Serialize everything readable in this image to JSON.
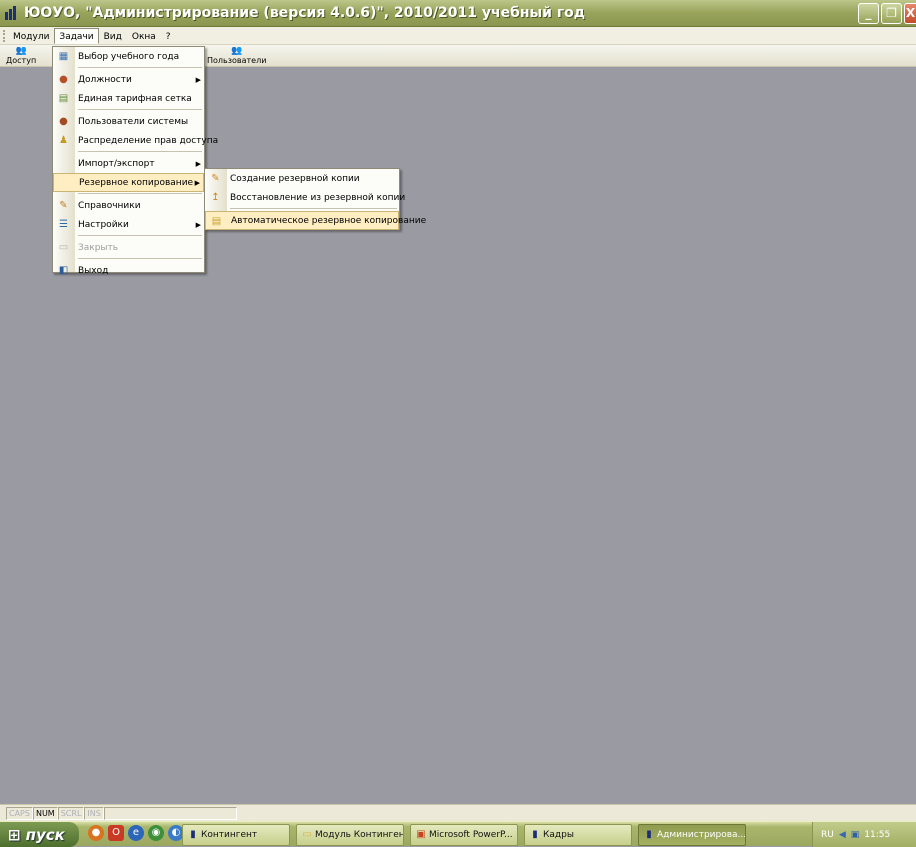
{
  "window": {
    "title": "ЮОУО, \"Администрирование (версия 4.0.6)\", 2010/2011 учебный год",
    "buttons": [
      "_",
      "❐",
      "X"
    ]
  },
  "menubar": {
    "items": [
      "Модули",
      "Задачи",
      "Вид",
      "Окна",
      "?"
    ],
    "active": "Задачи"
  },
  "toolbar": {
    "doc_label": "Доступ",
    "users_label": "Пользователи"
  },
  "tasks_menu": {
    "items": [
      {
        "label": "Выбор учебного года",
        "icon": "calendar-icon"
      },
      {
        "label": "Должности",
        "icon": "positions-icon",
        "submenu": true
      },
      {
        "label": "Единая тарифная сетка",
        "icon": "tariff-grid-icon"
      },
      {
        "label": "Пользователи системы",
        "icon": "users-icon"
      },
      {
        "label": "Распределение прав доступа",
        "icon": "access-rights-icon"
      },
      {
        "label": "Импорт/экспорт",
        "icon": "none",
        "submenu": true
      },
      {
        "label": "Резервное копирование",
        "icon": "none",
        "submenu": true,
        "highlighted": true
      },
      {
        "label": "Справочники",
        "icon": "directories-icon"
      },
      {
        "label": "Настройки",
        "icon": "settings-icon",
        "submenu": true
      },
      {
        "label": "Закрыть",
        "icon": "close-doc-icon",
        "disabled": true
      },
      {
        "label": "Выход",
        "icon": "exit-icon"
      }
    ]
  },
  "backup_submenu": {
    "items": [
      {
        "label": "Создание резервной копии",
        "icon": "create-backup-icon"
      },
      {
        "label": "Восстановление из резервной копии",
        "icon": "restore-backup-icon"
      },
      {
        "label": "Автоматическое резервное копирование",
        "icon": "auto-backup-icon",
        "highlighted": true
      }
    ]
  },
  "statusbar": {
    "indicators": [
      {
        "label": "CAPS",
        "on": false
      },
      {
        "label": "NUM",
        "on": true
      },
      {
        "label": "SCRL",
        "on": false
      },
      {
        "label": "INS",
        "on": false
      }
    ]
  },
  "taskbar": {
    "start_label": "пуск",
    "tasks": [
      {
        "label": "Контингент",
        "active": false
      },
      {
        "label": "Модуль Контингент",
        "active": false
      },
      {
        "label": "Microsoft PowerP...",
        "active": false
      },
      {
        "label": "Кадры",
        "active": false
      },
      {
        "label": "Администрирова...",
        "active": true
      }
    ],
    "tray": {
      "lang": "RU",
      "time": "11:55"
    }
  },
  "colors": {
    "workspace": "#9a9aa2",
    "titlebar": "#98a35a",
    "menu_highlight": "#ffeec2"
  }
}
